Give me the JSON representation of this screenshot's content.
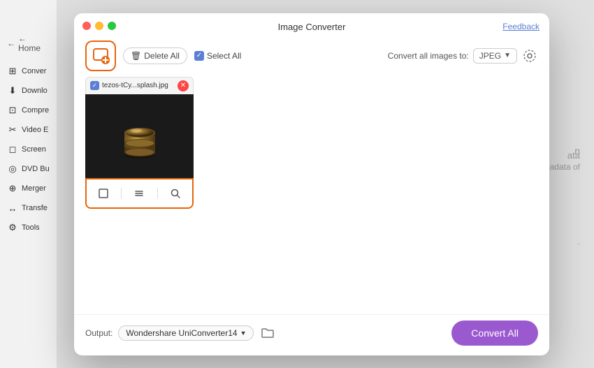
{
  "sidebar": {
    "home_label": "← Home",
    "items": [
      {
        "id": "convert",
        "label": "Conver",
        "icon": "⊞"
      },
      {
        "id": "download",
        "label": "Downlo",
        "icon": "⬇"
      },
      {
        "id": "compress",
        "label": "Compre",
        "icon": "⊡"
      },
      {
        "id": "video-edit",
        "label": "Video E",
        "icon": "✂"
      },
      {
        "id": "screen",
        "label": "Screen",
        "icon": "📷"
      },
      {
        "id": "dvd-burn",
        "label": "DVD Bu",
        "icon": "💿"
      },
      {
        "id": "merger",
        "label": "Merger",
        "icon": "⊕"
      },
      {
        "id": "transfer",
        "label": "Transfe",
        "icon": "↔"
      },
      {
        "id": "tools",
        "label": "Tools",
        "icon": "🔧"
      }
    ]
  },
  "modal": {
    "title": "Image Converter",
    "feedback_label": "Feedback",
    "toolbar": {
      "delete_all_label": "Delete All",
      "select_all_label": "Select All",
      "convert_format_label": "Convert all images to:",
      "format": "JPEG"
    },
    "image": {
      "filename": "tezos-tCy...splash.jpg",
      "alt": "coin on dark background"
    },
    "action_icons": {
      "crop": "⊡",
      "list": "≡",
      "zoom": "🔍"
    },
    "footer": {
      "output_label": "Output:",
      "output_path": "Wondershare UniConverter14",
      "convert_all_label": "Convert All"
    }
  },
  "background": {
    "text1": "n",
    "text2": "ata",
    "text3": "adata of",
    "text4": "."
  }
}
